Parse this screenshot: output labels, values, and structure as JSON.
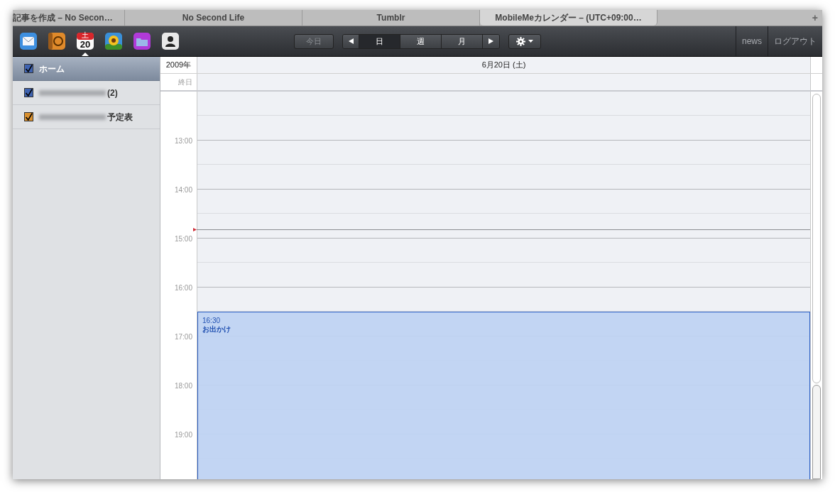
{
  "tabs": [
    {
      "label": "記事を作成 – No Secon…",
      "selected": false
    },
    {
      "label": "No Second Life",
      "selected": false
    },
    {
      "label": "Tumblr",
      "selected": false
    },
    {
      "label": "MobileMeカレンダー – (UTC+09:00…",
      "selected": true
    }
  ],
  "new_tab": "+",
  "apps": [
    {
      "kind": "mail",
      "selected": false
    },
    {
      "kind": "address",
      "selected": false
    },
    {
      "kind": "calendar",
      "selected": true,
      "day": "20",
      "weekday": "土"
    },
    {
      "kind": "gallery",
      "selected": false
    },
    {
      "kind": "idisk",
      "selected": false
    },
    {
      "kind": "account",
      "selected": false
    }
  ],
  "today_button": {
    "label": "今日",
    "disabled": true
  },
  "views": [
    {
      "label": "日",
      "selected": true
    },
    {
      "label": "週",
      "selected": false
    },
    {
      "label": "月",
      "selected": false
    }
  ],
  "header_links": [
    "news",
    "ログアウト"
  ],
  "calendars": [
    {
      "label": "ホーム",
      "redacted": false,
      "checked": true,
      "selected": true,
      "color": "#3f63b0"
    },
    {
      "label": "(2)",
      "redacted": true,
      "checked": true,
      "selected": false,
      "color": "#3f63b0"
    },
    {
      "label": "予定表",
      "redacted": true,
      "checked": true,
      "selected": false,
      "color": "#d9902f"
    }
  ],
  "day_view": {
    "year": "2009年",
    "date": "6月20日 (土)",
    "all_day_label": "終日",
    "hours": [
      "13:00",
      "14:00",
      "15:00",
      "16:00",
      "17:00",
      "18:00",
      "19:00"
    ],
    "events": [
      {
        "time": "16:30",
        "title": "お出かけ"
      }
    ]
  }
}
